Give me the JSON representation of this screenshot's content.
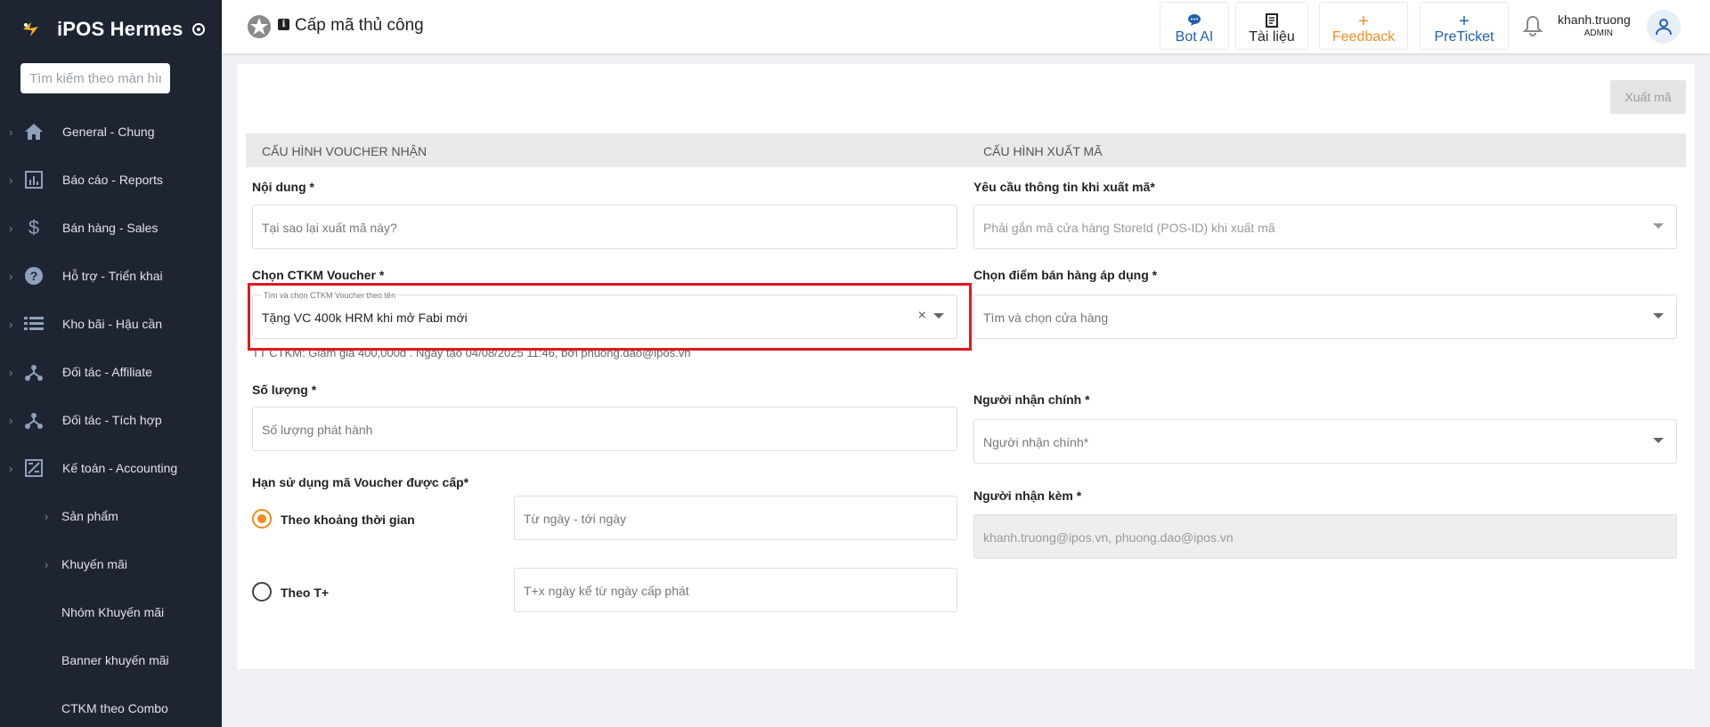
{
  "sidebar": {
    "brand": "iPOS Hermes",
    "search_placeholder": "Tìm kiếm theo màn hình...",
    "items": [
      {
        "label": "General - Chung",
        "icon": "home-icon"
      },
      {
        "label": "Báo cáo - Reports",
        "icon": "report-icon"
      },
      {
        "label": "Bán hàng - Sales",
        "icon": "dollar-icon"
      },
      {
        "label": "Hỗ trợ - Triển khai",
        "icon": "help-icon"
      },
      {
        "label": "Kho bãi - Hậu cần",
        "icon": "list-icon"
      },
      {
        "label": "Đối tác - Affiliate",
        "icon": "network-icon"
      },
      {
        "label": "Đối tác - Tích hợp",
        "icon": "network-icon"
      },
      {
        "label": "Kế toán - Accounting",
        "icon": "accounting-icon"
      }
    ],
    "sub_items": [
      {
        "label": "Sản phẩm",
        "has_chevron": true
      },
      {
        "label": "Khuyến mãi",
        "has_chevron": true
      },
      {
        "label": "Nhóm Khuyến mãi",
        "has_chevron": false
      },
      {
        "label": "Banner khuyến mãi",
        "has_chevron": false
      },
      {
        "label": "CTKM theo Combo",
        "has_chevron": false
      }
    ]
  },
  "header": {
    "title": "Cấp mã thủ công",
    "buttons": [
      {
        "label": "Bot AI",
        "icon": "chat-icon",
        "color": "#1f5fae"
      },
      {
        "label": "Tài liệu",
        "icon": "book-icon",
        "color": "#222222"
      },
      {
        "label": "Feedback",
        "icon": "plus-icon",
        "color": "#f0902a"
      },
      {
        "label": "PreTicket",
        "icon": "plus-icon",
        "color": "#1f5fae"
      }
    ],
    "user_name": "khanh.truong",
    "user_role": "ADMIN"
  },
  "form": {
    "export_button": "Xuất mã",
    "section_left": "CẤU HÌNH VOUCHER NHẬN",
    "section_right": "CẤU HÌNH XUẤT MÃ",
    "noi_dung_label": "Nội dung *",
    "noi_dung_placeholder": "Tại sao lại xuất mã này?",
    "ctkm_label": "Chọn CTKM Voucher *",
    "ctkm_floating_label": "Tìm và chọn CTKM Voucher theo tên",
    "ctkm_value": "Tặng VC 400k HRM khi mở Fabi mới",
    "ctkm_note": "TT CTKM: Giảm giá 400,000đ . Ngày tạo 04/08/2025 11:46, bởi phuong.dao@ipos.vn",
    "so_luong_label": "Số lượng *",
    "so_luong_placeholder": "Số lượng phát hành",
    "han_su_dung_label": "Hạn sử dụng mã Voucher được cấp*",
    "option_time_label": "Theo khoảng thời gian",
    "option_time_placeholder": "Từ ngày - tới ngày",
    "option_t_label": "Theo T+",
    "option_t_placeholder": "T+x ngày kể từ ngày cấp phát",
    "yeu_cau_label": "Yêu cầu thông tin khi xuất mã*",
    "yeu_cau_placeholder": "Phải gắn mã cửa hàng StoreId (POS-ID) khi xuất mã",
    "diem_ban_label": "Chọn điểm bán hàng áp dụng *",
    "diem_ban_placeholder": "Tìm và chọn cửa hàng",
    "nguoi_nhan_label": "Người nhận chính *",
    "nguoi_nhan_placeholder": "Người nhận chính*",
    "nguoi_kem_label": "Người nhận kèm *",
    "nguoi_kem_value": "khanh.truong@ipos.vn, phuong.dao@ipos.vn"
  }
}
